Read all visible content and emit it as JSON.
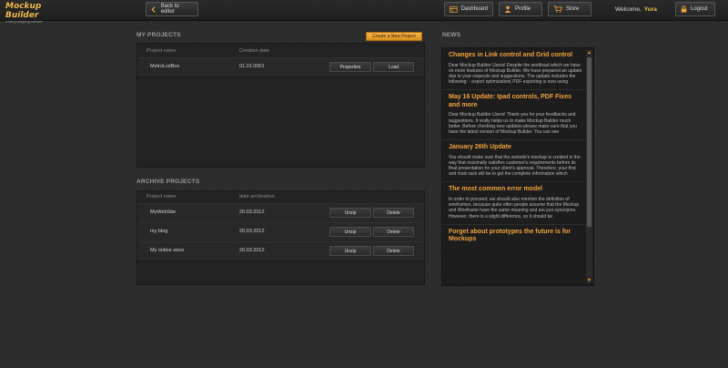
{
  "header": {
    "logo_title": "Mockup Builder",
    "logo_tagline": "a fast prototyping software",
    "back_label": "Back to editor",
    "dashboard_label": "Dashboard",
    "profile_label": "Profile",
    "store_label": "Store",
    "welcome_text": "Welcome,",
    "username": "Yura",
    "logout_label": "Logout"
  },
  "my_projects": {
    "title": "MY PROJECTS",
    "create_label": "Create a New Project",
    "col_name": "Project name",
    "col_date": "Creation date",
    "rows": [
      {
        "name": "MetroListBox",
        "date": "01.01.0001",
        "btn1": "Properties",
        "btn2": "Load"
      }
    ]
  },
  "archive": {
    "title": "ARCHIVE PROJECTS",
    "col_name": "Project name",
    "col_date": "date archivation",
    "rows": [
      {
        "name": "MyWebSite",
        "date": "20.03.2012",
        "btn1": "Unzip",
        "btn2": "Delete"
      },
      {
        "name": "my blog",
        "date": "20.03.2012",
        "btn1": "Unzip",
        "btn2": "Delete"
      },
      {
        "name": "My online store",
        "date": "20.03.2012",
        "btn1": "Unzip",
        "btn2": "Delete"
      }
    ]
  },
  "news": {
    "title": "NEWS",
    "items": [
      {
        "title": "Changes in Link control and Grid control",
        "text": "Dear Mockup Builder Users! Despite the workload which we have on more features of Mockup Builder. We have prepared an update due to your requests and suggestions. The update includes the following: - export optimization( PDF exporting is now using"
      },
      {
        "title": "May 16 Update: Ipad controls, PDF Fixes and more",
        "text": "Dear Mockup Builder Users! Thank you for your feedbacks and suggestions. It really helps us to make Mockup Builder much better. Before checking new updates please make sure that you have the latest version of Mockup Builder. You can see"
      },
      {
        "title": "January 26th Update",
        "text": "You should make sure that the website's mockup is created in the way that maximally satisfies customer's requirements before its final presentation for your client's approval. Therefore, your first and main task will be to get the complete information which"
      },
      {
        "title": "The most common error model",
        "text": "In order to proceed, we should also mention the definition of wireframes, because quite often people assume that the Mockup and Wireframe have the same meaning and are just synonyms. However, there is a slight difference, so it should be"
      },
      {
        "title": "Forget about prototypes the future is for Mockups",
        "text": ""
      }
    ]
  },
  "colors": {
    "accent": "#f2a33a",
    "background": "#2b2b2b",
    "panel": "#232323"
  }
}
